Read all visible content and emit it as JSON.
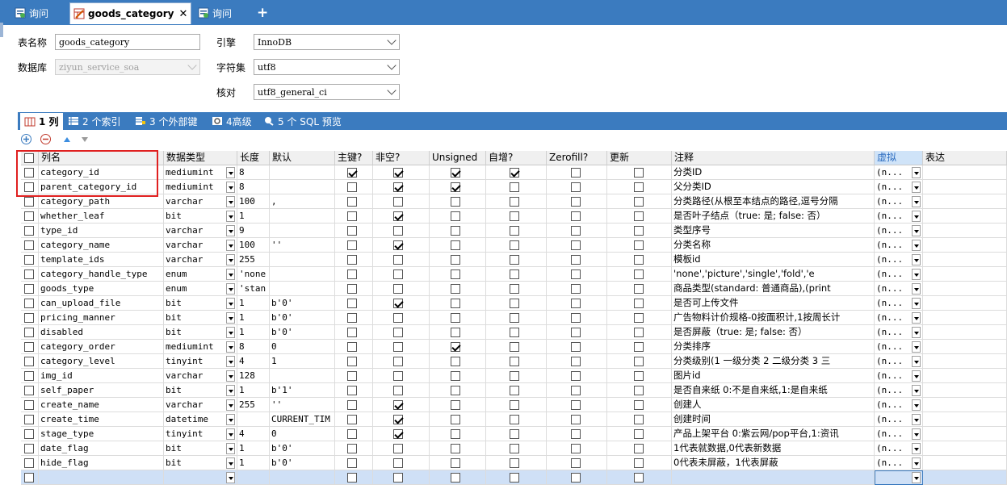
{
  "tabs": [
    {
      "label": "询问",
      "active": false
    },
    {
      "label": "goods_category",
      "active": true
    },
    {
      "label": "询问",
      "active": false
    }
  ],
  "props": {
    "table_name_label": "表名称",
    "table_name_value": "goods_category",
    "database_label": "数据库",
    "database_value": "ziyun_service_soa",
    "engine_label": "引擎",
    "engine_value": "InnoDB",
    "charset_label": "字符集",
    "charset_value": "utf8",
    "collation_label": "核对",
    "collation_value": "utf8_general_ci"
  },
  "inner_tabs": [
    {
      "label": "1 列",
      "active": true
    },
    {
      "label": "2 个索引",
      "active": false
    },
    {
      "label": "3 个外部键",
      "active": false
    },
    {
      "label": "4高级",
      "active": false
    },
    {
      "label": "5 个 SQL 预览",
      "active": false
    }
  ],
  "columns_header": [
    "列名",
    "数据类型",
    "长度",
    "默认",
    "主键?",
    "非空?",
    "Unsigned",
    "自增?",
    "Zerofill?",
    "更新",
    "注释",
    "虚拟",
    "表达"
  ],
  "rows": [
    {
      "name": "category_id",
      "type": "mediumint",
      "len": "8",
      "def": "",
      "pk": true,
      "nn": true,
      "uns": true,
      "ai": true,
      "zf": false,
      "upd": false,
      "comment": "分类ID",
      "virt": "(n..."
    },
    {
      "name": "parent_category_id",
      "type": "mediumint",
      "len": "8",
      "def": "",
      "pk": false,
      "nn": true,
      "uns": true,
      "ai": false,
      "zf": false,
      "upd": false,
      "comment": "父分类ID",
      "virt": "(n..."
    },
    {
      "name": "category_path",
      "type": "varchar",
      "len": "100",
      "def": ",",
      "pk": false,
      "nn": false,
      "uns": false,
      "ai": false,
      "zf": false,
      "upd": false,
      "comment": "分类路径(从根至本结点的路径,逗号分隔",
      "virt": "(n..."
    },
    {
      "name": "whether_leaf",
      "type": "bit",
      "len": "1",
      "def": "",
      "pk": false,
      "nn": true,
      "uns": false,
      "ai": false,
      "zf": false,
      "upd": false,
      "comment": "是否叶子结点（true: 是; false: 否）",
      "virt": "(n..."
    },
    {
      "name": "type_id",
      "type": "varchar",
      "len": "9",
      "def": "",
      "pk": false,
      "nn": false,
      "uns": false,
      "ai": false,
      "zf": false,
      "upd": false,
      "comment": "类型序号",
      "virt": "(n..."
    },
    {
      "name": "category_name",
      "type": "varchar",
      "len": "100",
      "def": "''",
      "pk": false,
      "nn": true,
      "uns": false,
      "ai": false,
      "zf": false,
      "upd": false,
      "comment": "分类名称",
      "virt": "(n..."
    },
    {
      "name": "template_ids",
      "type": "varchar",
      "len": "255",
      "def": "",
      "pk": false,
      "nn": false,
      "uns": false,
      "ai": false,
      "zf": false,
      "upd": false,
      "comment": "模板id",
      "virt": "(n..."
    },
    {
      "name": "category_handle_type",
      "type": "enum",
      "len": "'none",
      "def": "",
      "pk": false,
      "nn": false,
      "uns": false,
      "ai": false,
      "zf": false,
      "upd": false,
      "comment": "'none','picture','single','fold','e",
      "virt": "(n..."
    },
    {
      "name": "goods_type",
      "type": "enum",
      "len": "'stan",
      "def": "",
      "pk": false,
      "nn": false,
      "uns": false,
      "ai": false,
      "zf": false,
      "upd": false,
      "comment": "商品类型(standard: 普通商品),(print",
      "virt": "(n..."
    },
    {
      "name": "can_upload_file",
      "type": "bit",
      "len": "1",
      "def": "b'0'",
      "pk": false,
      "nn": true,
      "uns": false,
      "ai": false,
      "zf": false,
      "upd": false,
      "comment": "是否可上传文件",
      "virt": "(n..."
    },
    {
      "name": "pricing_manner",
      "type": "bit",
      "len": "1",
      "def": "b'0'",
      "pk": false,
      "nn": false,
      "uns": false,
      "ai": false,
      "zf": false,
      "upd": false,
      "comment": "广告物料计价规格-0按面积计,1按周长计",
      "virt": "(n..."
    },
    {
      "name": "disabled",
      "type": "bit",
      "len": "1",
      "def": "b'0'",
      "pk": false,
      "nn": false,
      "uns": false,
      "ai": false,
      "zf": false,
      "upd": false,
      "comment": "是否屏蔽（true: 是; false: 否）",
      "virt": "(n..."
    },
    {
      "name": "category_order",
      "type": "mediumint",
      "len": "8",
      "def": "0",
      "pk": false,
      "nn": false,
      "uns": true,
      "ai": false,
      "zf": false,
      "upd": false,
      "comment": "分类排序",
      "virt": "(n..."
    },
    {
      "name": "category_level",
      "type": "tinyint",
      "len": "4",
      "def": "1",
      "pk": false,
      "nn": false,
      "uns": false,
      "ai": false,
      "zf": false,
      "upd": false,
      "comment": "分类级别(1 一级分类 2 二级分类 3 三",
      "virt": "(n..."
    },
    {
      "name": "img_id",
      "type": "varchar",
      "len": "128",
      "def": "",
      "pk": false,
      "nn": false,
      "uns": false,
      "ai": false,
      "zf": false,
      "upd": false,
      "comment": "图片id",
      "virt": "(n..."
    },
    {
      "name": "self_paper",
      "type": "bit",
      "len": "1",
      "def": "b'1'",
      "pk": false,
      "nn": false,
      "uns": false,
      "ai": false,
      "zf": false,
      "upd": false,
      "comment": "是否自来纸 0:不是自来纸,1:是自来纸",
      "virt": "(n..."
    },
    {
      "name": "create_name",
      "type": "varchar",
      "len": "255",
      "def": "''",
      "pk": false,
      "nn": true,
      "uns": false,
      "ai": false,
      "zf": false,
      "upd": false,
      "comment": "创建人",
      "virt": "(n..."
    },
    {
      "name": "create_time",
      "type": "datetime",
      "len": "",
      "def": "CURRENT_TIM",
      "pk": false,
      "nn": true,
      "uns": false,
      "ai": false,
      "zf": false,
      "upd": false,
      "comment": "创建时间",
      "virt": "(n..."
    },
    {
      "name": "stage_type",
      "type": "tinyint",
      "len": "4",
      "def": "0",
      "pk": false,
      "nn": true,
      "uns": false,
      "ai": false,
      "zf": false,
      "upd": false,
      "comment": "产品上架平台 0:紫云网/pop平台,1:资讯",
      "virt": "(n..."
    },
    {
      "name": "date_flag",
      "type": "bit",
      "len": "1",
      "def": "b'0'",
      "pk": false,
      "nn": false,
      "uns": false,
      "ai": false,
      "zf": false,
      "upd": false,
      "comment": "1代表就数据,0代表新数据",
      "virt": "(n..."
    },
    {
      "name": "hide_flag",
      "type": "bit",
      "len": "1",
      "def": "b'0'",
      "pk": false,
      "nn": false,
      "uns": false,
      "ai": false,
      "zf": false,
      "upd": false,
      "comment": "0代表未屏蔽，1代表屏蔽",
      "virt": "(n..."
    }
  ]
}
